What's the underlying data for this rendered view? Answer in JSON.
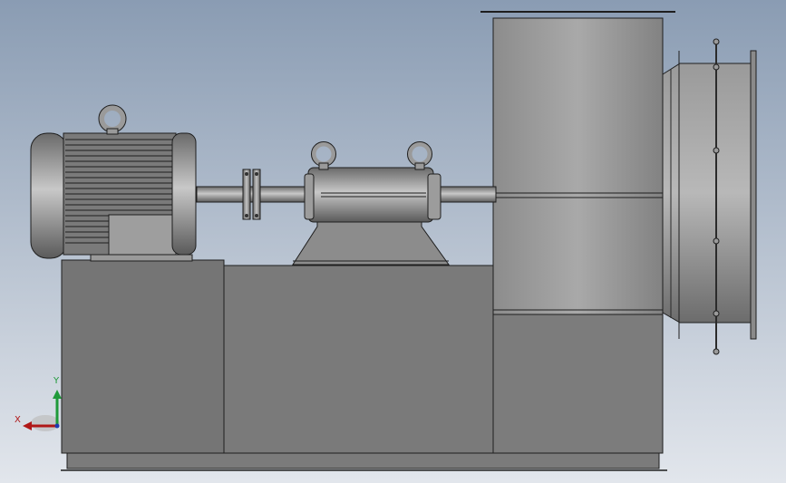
{
  "scene": {
    "description_type": "cad-viewport",
    "background": {
      "top": "#8a9cb3",
      "bottom": "#dfe4ea"
    }
  },
  "colors": {
    "body_dark": "#6f6f6f",
    "body_mid": "#8a8a8a",
    "body_light": "#b5b5b5",
    "outline": "#1e1e1e",
    "axis_x": "#b01818",
    "axis_y": "#1f9a3a",
    "axis_z": "#1f3ab0"
  },
  "triad": {
    "x_label": "X",
    "y_label": "Y"
  }
}
